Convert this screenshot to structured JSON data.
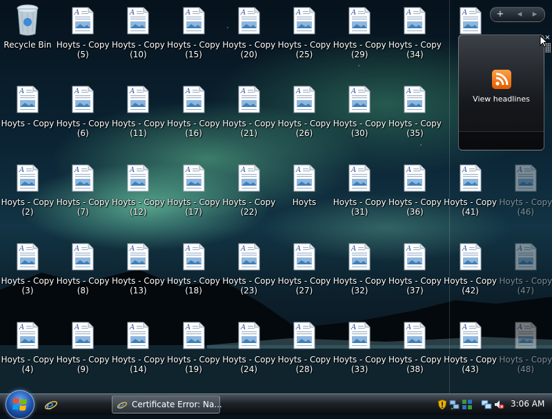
{
  "desktop": {
    "recycle_bin": {
      "label": "Recycle Bin"
    },
    "icons": [
      {
        "col": 1,
        "row": 0,
        "line1": "Hoyts - Copy",
        "line2": "(5)"
      },
      {
        "col": 2,
        "row": 0,
        "line1": "Hoyts - Copy",
        "line2": "(10)"
      },
      {
        "col": 3,
        "row": 0,
        "line1": "Hoyts - Copy",
        "line2": "(15)"
      },
      {
        "col": 4,
        "row": 0,
        "line1": "Hoyts - Copy",
        "line2": "(20)"
      },
      {
        "col": 5,
        "row": 0,
        "line1": "Hoyts - Copy",
        "line2": "(25)"
      },
      {
        "col": 6,
        "row": 0,
        "line1": "Hoyts - Copy",
        "line2": "(29)"
      },
      {
        "col": 7,
        "row": 0,
        "line1": "Hoyts - Copy",
        "line2": "(34)"
      },
      {
        "col": 8,
        "row": 0,
        "line1": "Ho",
        "line2": ""
      },
      {
        "col": 0,
        "row": 1,
        "line1": "Hoyts - Copy",
        "line2": ""
      },
      {
        "col": 1,
        "row": 1,
        "line1": "Hoyts - Copy",
        "line2": "(6)"
      },
      {
        "col": 2,
        "row": 1,
        "line1": "Hoyts - Copy",
        "line2": "(11)"
      },
      {
        "col": 3,
        "row": 1,
        "line1": "Hoyts - Copy",
        "line2": "(16)"
      },
      {
        "col": 4,
        "row": 1,
        "line1": "Hoyts - Copy",
        "line2": "(21)"
      },
      {
        "col": 5,
        "row": 1,
        "line1": "Hoyts - Copy",
        "line2": "(26)"
      },
      {
        "col": 6,
        "row": 1,
        "line1": "Hoyts - Copy",
        "line2": "(30)"
      },
      {
        "col": 7,
        "row": 1,
        "line1": "Hoyts - Copy",
        "line2": "(35)"
      },
      {
        "col": 8,
        "row": 1,
        "line1": "Ho",
        "line2": ""
      },
      {
        "col": 0,
        "row": 2,
        "line1": "Hoyts - Copy",
        "line2": "(2)"
      },
      {
        "col": 1,
        "row": 2,
        "line1": "Hoyts - Copy",
        "line2": "(7)"
      },
      {
        "col": 2,
        "row": 2,
        "line1": "Hoyts - Copy",
        "line2": "(12)"
      },
      {
        "col": 3,
        "row": 2,
        "line1": "Hoyts - Copy",
        "line2": "(17)"
      },
      {
        "col": 4,
        "row": 2,
        "line1": "Hoyts - Copy",
        "line2": "(22)"
      },
      {
        "col": 5,
        "row": 2,
        "line1": "Hoyts",
        "line2": ""
      },
      {
        "col": 6,
        "row": 2,
        "line1": "Hoyts - Copy",
        "line2": "(31)"
      },
      {
        "col": 7,
        "row": 2,
        "line1": "Hoyts - Copy",
        "line2": "(36)"
      },
      {
        "col": 8,
        "row": 2,
        "line1": "Hoyts - Copy",
        "line2": "(41)"
      },
      {
        "col": 9,
        "row": 2,
        "line1": "Hoyts - Copy",
        "line2": "(46)",
        "faded": true
      },
      {
        "col": 0,
        "row": 3,
        "line1": "Hoyts - Copy",
        "line2": "(3)"
      },
      {
        "col": 1,
        "row": 3,
        "line1": "Hoyts - Copy",
        "line2": "(8)"
      },
      {
        "col": 2,
        "row": 3,
        "line1": "Hoyts - Copy",
        "line2": "(13)"
      },
      {
        "col": 3,
        "row": 3,
        "line1": "Hoyts - Copy",
        "line2": "(18)"
      },
      {
        "col": 4,
        "row": 3,
        "line1": "Hoyts - Copy",
        "line2": "(23)"
      },
      {
        "col": 5,
        "row": 3,
        "line1": "Hoyts - Copy",
        "line2": "(27)"
      },
      {
        "col": 6,
        "row": 3,
        "line1": "Hoyts - Copy",
        "line2": "(32)"
      },
      {
        "col": 7,
        "row": 3,
        "line1": "Hoyts - Copy",
        "line2": "(37)"
      },
      {
        "col": 8,
        "row": 3,
        "line1": "Hoyts - Copy",
        "line2": "(42)"
      },
      {
        "col": 9,
        "row": 3,
        "line1": "Hoyts - Copy",
        "line2": "(47)",
        "faded": true
      },
      {
        "col": 0,
        "row": 4,
        "line1": "Hoyts - Copy",
        "line2": "(4)"
      },
      {
        "col": 1,
        "row": 4,
        "line1": "Hoyts - Copy",
        "line2": "(9)"
      },
      {
        "col": 2,
        "row": 4,
        "line1": "Hoyts - Copy",
        "line2": "(14)"
      },
      {
        "col": 3,
        "row": 4,
        "line1": "Hoyts - Copy",
        "line2": "(19)"
      },
      {
        "col": 4,
        "row": 4,
        "line1": "Hoyts - Copy",
        "line2": "(24)"
      },
      {
        "col": 5,
        "row": 4,
        "line1": "Hoyts - Copy",
        "line2": "(28)"
      },
      {
        "col": 6,
        "row": 4,
        "line1": "Hoyts - Copy",
        "line2": "(33)"
      },
      {
        "col": 7,
        "row": 4,
        "line1": "Hoyts - Copy",
        "line2": "(38)"
      },
      {
        "col": 8,
        "row": 4,
        "line1": "Hoyts - Copy",
        "line2": "(43)"
      },
      {
        "col": 9,
        "row": 4,
        "line1": "Hoyts - Copy",
        "line2": "(48)",
        "faded": true
      }
    ]
  },
  "sidebar": {
    "toolbar": {
      "add_glyph": "+",
      "prev_glyph": "◂",
      "next_glyph": "▸"
    },
    "feed_gadget": {
      "label": "View headlines",
      "icon": "rss-icon"
    },
    "close_glyph": "×"
  },
  "taskbar": {
    "start": {
      "icon": "windows-start-orb-icon"
    },
    "quick_launch": [
      {
        "icon": "internet-explorer-icon"
      }
    ],
    "tasks": [
      {
        "label": "Certificate Error: Na...",
        "icon": "internet-explorer-icon"
      }
    ],
    "tray": {
      "icons": [
        "security-shield-icon",
        "network-icon",
        "windows-defender-icon",
        "network-connection-icon",
        "volume-muted-icon"
      ],
      "clock": "3:06 AM"
    }
  },
  "colors": {
    "aurora": "#8ff0c0",
    "rss_orange": "#f27a10",
    "taskbar": "#1d2329"
  }
}
